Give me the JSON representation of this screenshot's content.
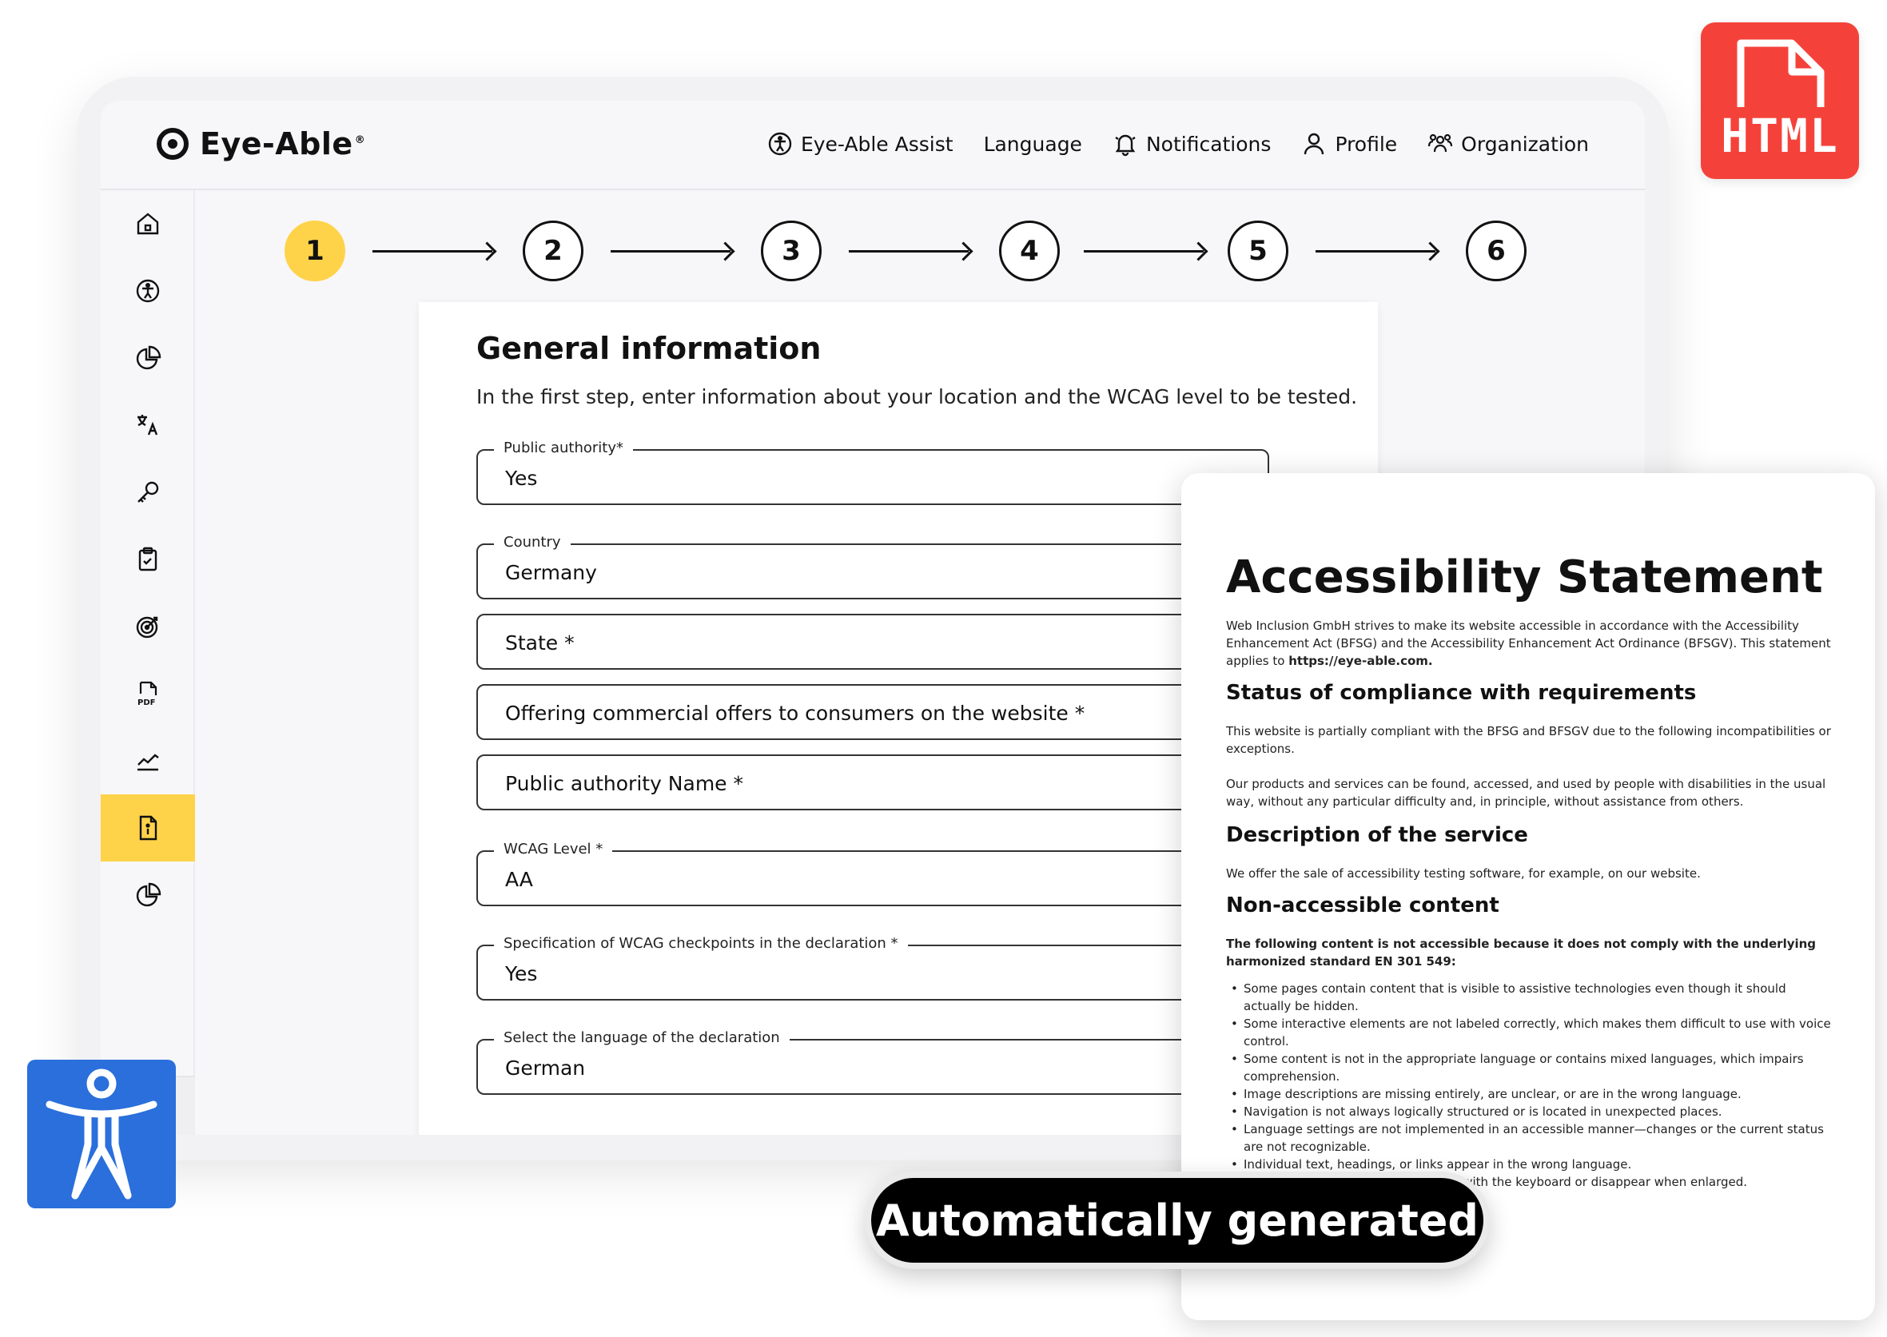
{
  "brand": {
    "name": "Eye-Able",
    "registered": "®"
  },
  "nav": {
    "assist": "Eye-Able Assist",
    "language": "Language",
    "notifications": "Notifications",
    "profile": "Profile",
    "organization": "Organization"
  },
  "sidebar": {
    "items": [
      {
        "icon": "home-icon"
      },
      {
        "icon": "accessibility-icon"
      },
      {
        "icon": "pie-chart-icon"
      },
      {
        "icon": "translate-icon"
      },
      {
        "icon": "key-icon"
      },
      {
        "icon": "clipboard-check-icon"
      },
      {
        "icon": "target-icon"
      },
      {
        "icon": "pdf-icon"
      },
      {
        "icon": "line-chart-icon"
      },
      {
        "icon": "info-document-icon",
        "active": true
      },
      {
        "icon": "pie-chart-icon"
      }
    ],
    "bottom_icon": "chat-help-icon",
    "accent_color": "#fed34a"
  },
  "stepper": {
    "steps": [
      "1",
      "2",
      "3",
      "4",
      "5",
      "6"
    ],
    "active_index": 0
  },
  "form": {
    "title": "General information",
    "intro": "In the first step, enter information about your location and the WCAG level to be tested.",
    "fields": [
      {
        "label": "Public authority*",
        "value": "Yes"
      },
      {
        "label": "Country",
        "value": "Germany"
      },
      {
        "label": "",
        "placeholder": "State *"
      },
      {
        "label": "",
        "placeholder": "Offering commercial offers to consumers on the website *"
      },
      {
        "label": "",
        "placeholder": "Public authority Name *"
      },
      {
        "label": "WCAG Level *",
        "value": "AA"
      },
      {
        "label": "Specification of WCAG checkpoints in the declaration *",
        "value": "Yes"
      },
      {
        "label": "Select the language of the declaration",
        "value": "German"
      }
    ]
  },
  "document": {
    "title": "Accessibility Statement",
    "intro_prefix": "Web Inclusion GmbH strives to make its website accessible in accordance with the Accessibility Enhancement Act (BFSG) and the Accessibility Enhancement Act Ordinance (BFSGV). This statement applies to ",
    "intro_link": "https://eye-able.com.",
    "h_status": "Status of compliance with requirements",
    "p_status": "This website is partially compliant with the BFSG and BFSGV due to the following incompatibilities or exceptions.",
    "p_products": "Our products and services can be found, accessed, and used by people with disabilities in the usual way, without any particular difficulty and, in principle, without assistance from others.",
    "h_service": "Description of the service",
    "p_service": "We offer the sale of accessibility testing software, for example, on our website.",
    "h_nonaccess": "Non-accessible content",
    "p_nonaccess": "The following content is not accessible because it does not comply with the underlying harmonized standard EN 301 549:",
    "list": [
      "Some pages contain content that is visible to assistive technologies even though it should actually be hidden.",
      "Some interactive elements are not labeled correctly, which makes them difficult to use with voice control.",
      "Some content is not in the appropriate language or contains mixed languages, which impairs comprehension.",
      "Image descriptions are missing entirely, are unclear, or are in the wrong language.",
      "Navigation is not always logically structured or is located in unexpected places.",
      "Language settings are not implemented in an accessible manner—changes or the current status are not recognizable.",
      "Individual text, headings, or links appear in the wrong language.",
      "Some elements cannot be operated with the keyboard or disappear when enlarged."
    ]
  },
  "badges": {
    "html": "HTML",
    "html_color": "#f4423a",
    "access_color": "#2a6fdb",
    "pill": "Automatically generated"
  }
}
